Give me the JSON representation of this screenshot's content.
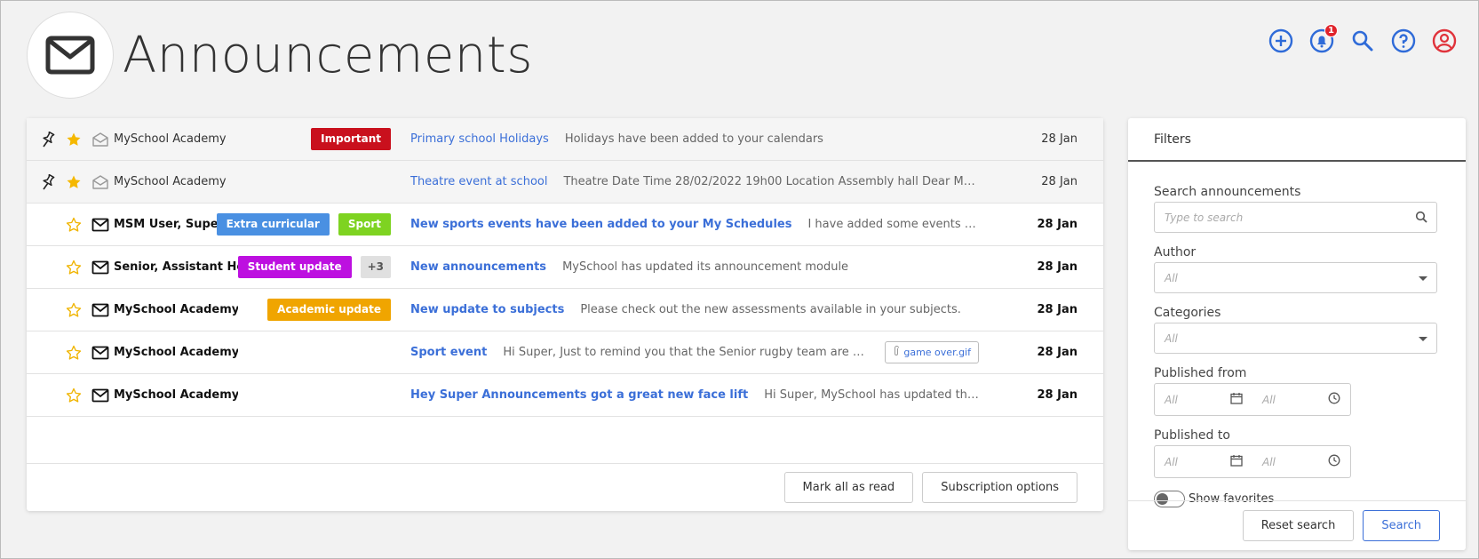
{
  "page": {
    "title": "Announcements"
  },
  "header_icons": [
    {
      "name": "add-icon",
      "color": "#2f6bd8"
    },
    {
      "name": "bell-icon",
      "color": "#2f6bd8",
      "badge": "1"
    },
    {
      "name": "search-icon",
      "color": "#2f6bd8"
    },
    {
      "name": "help-icon",
      "color": "#2f6bd8"
    },
    {
      "name": "user-icon",
      "color": "#e0333b"
    }
  ],
  "announcements": [
    {
      "pinned": true,
      "starred": true,
      "read": true,
      "author": "MySchool Academy",
      "tags": [
        {
          "label": "Important",
          "color": "#c9101d"
        }
      ],
      "subject": "Primary school Holidays",
      "preview": "Holidays have been added to your calendars",
      "date": "28 Jan"
    },
    {
      "pinned": true,
      "starred": true,
      "read": true,
      "author": "MySchool Academy",
      "tags": [],
      "subject": "Theatre event at school",
      "preview": "Theatre  Date Time 28/02/2022 19h00 Location Assembly hall   Dear MSM User, ...",
      "date": "28 Jan"
    },
    {
      "pinned": false,
      "starred": false,
      "read": false,
      "author": "MSM User, Super",
      "tags": [
        {
          "label": "Extra curricular",
          "color": "#4a90e2"
        },
        {
          "label": "Sport",
          "color": "#7ed321"
        }
      ],
      "subject": "New sports events have been added to your My Schedules",
      "preview": "I have added some events to your calendars",
      "date": "28 Jan"
    },
    {
      "pinned": false,
      "starred": false,
      "read": false,
      "author": "Senior, Assistant Head",
      "tags": [
        {
          "label": "Student update",
          "color": "#bd10e0"
        },
        {
          "label": "+3",
          "color": "#e0e0e0",
          "more": true
        }
      ],
      "subject": "New announcements",
      "preview": "MySchool has updated its announcement module",
      "date": "28 Jan"
    },
    {
      "pinned": false,
      "starred": false,
      "read": false,
      "author": "MySchool Academy",
      "tags": [
        {
          "label": "Academic update",
          "color": "#f0a500"
        }
      ],
      "subject": "New update to subjects",
      "preview": "Please check out the new assessments available in your subjects.",
      "date": "28 Jan"
    },
    {
      "pinned": false,
      "starred": false,
      "read": false,
      "author": "MySchool Academy",
      "tags": [],
      "subject": "Sport event",
      "preview": "Hi Super,   Just to remind you that the Senior rugby team are playing thi...",
      "attachment": "game over.gif",
      "date": "28 Jan"
    },
    {
      "pinned": false,
      "starred": false,
      "read": false,
      "author": "MySchool Academy",
      "tags": [],
      "subject": "Hey Super Announcements got a great new face lift",
      "preview": "Hi Super, MySchool has updated their announcemen...",
      "date": "28 Jan"
    }
  ],
  "list_footer": {
    "mark_read": "Mark all as read",
    "subscription": "Subscription options"
  },
  "filters": {
    "title": "Filters",
    "search_label": "Search announcements",
    "search_placeholder": "Type to search",
    "author_label": "Author",
    "author_value": "All",
    "categories_label": "Categories",
    "categories_value": "All",
    "published_from_label": "Published from",
    "published_to_label": "Published to",
    "date_value": "All",
    "time_value": "All",
    "favorites_label": "Show favorites",
    "reset": "Reset search",
    "search": "Search"
  }
}
